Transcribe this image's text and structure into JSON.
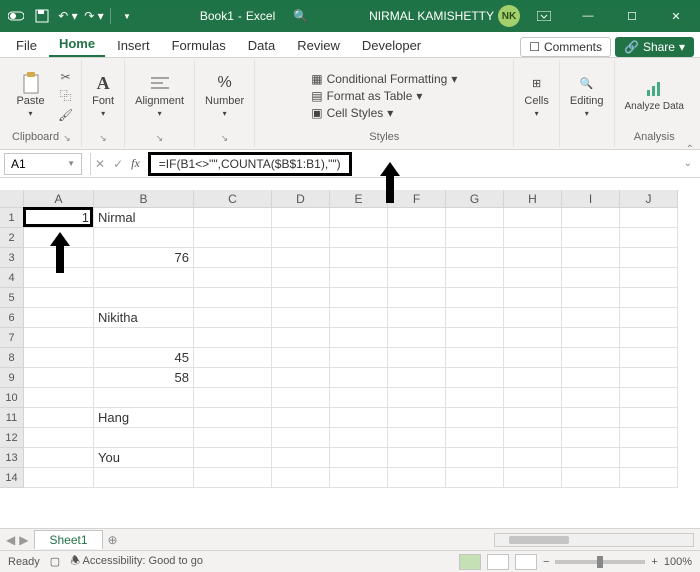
{
  "title": {
    "book": "Book1",
    "app": "Excel",
    "user": "NIRMAL KAMISHETTY",
    "initials": "NK"
  },
  "tabs": {
    "file": "File",
    "home": "Home",
    "insert": "Insert",
    "formulas": "Formulas",
    "data": "Data",
    "review": "Review",
    "developer": "Developer",
    "comments": "Comments",
    "share": "Share"
  },
  "ribbon": {
    "clipboard": "Clipboard",
    "paste": "Paste",
    "font": "Font",
    "alignment": "Alignment",
    "number": "Number",
    "styles": "Styles",
    "cond": "Conditional Formatting",
    "table": "Format as Table",
    "cellstyles": "Cell Styles",
    "cells": "Cells",
    "editing": "Editing",
    "analysis": "Analysis",
    "analyze": "Analyze Data"
  },
  "formula": {
    "cellref": "A1",
    "text": "=IF(B1<>\"\",COUNTA($B$1:B1),\"\")"
  },
  "cols": [
    "A",
    "B",
    "C",
    "D",
    "E",
    "F",
    "G",
    "H",
    "I",
    "J"
  ],
  "widths": [
    70,
    100,
    78,
    58,
    58,
    58,
    58,
    58,
    58,
    58
  ],
  "rows": [
    {
      "n": 1,
      "a": "1",
      "b": "Nirmal"
    },
    {
      "n": 2
    },
    {
      "n": 3,
      "b": "76"
    },
    {
      "n": 4
    },
    {
      "n": 5
    },
    {
      "n": 6,
      "b": "Nikitha"
    },
    {
      "n": 7
    },
    {
      "n": 8,
      "b": "45"
    },
    {
      "n": 9,
      "b": "58"
    },
    {
      "n": 10
    },
    {
      "n": 11,
      "b": "Hang"
    },
    {
      "n": 12
    },
    {
      "n": 13,
      "b": "You"
    },
    {
      "n": 14
    }
  ],
  "sheet": "Sheet1",
  "status": {
    "ready": "Ready",
    "access": "Accessibility: Good to go",
    "zoom": "100%"
  }
}
